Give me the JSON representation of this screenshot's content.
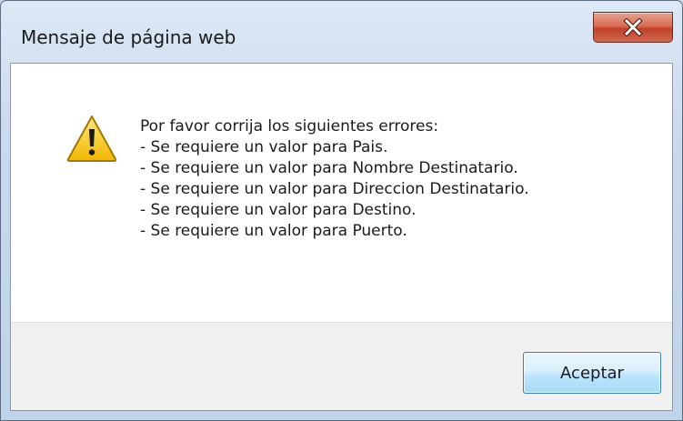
{
  "dialog": {
    "title": "Mensaje de página web",
    "close_icon": "close-icon",
    "warning_icon": "warning-icon",
    "message_lines": [
      "Por favor corrija los siguientes errores:",
      "- Se requiere un valor para Pais.",
      "- Se requiere un valor para Nombre Destinatario.",
      "- Se requiere un valor para Direccion Destinatario.",
      "- Se requiere un valor para Destino.",
      "- Se requiere un valor para Puerto."
    ],
    "ok_label": "Aceptar"
  },
  "colors": {
    "close_button": "#c2402a",
    "warning_fill": "#f5c400",
    "ok_button_border": "#3c7fb1"
  }
}
